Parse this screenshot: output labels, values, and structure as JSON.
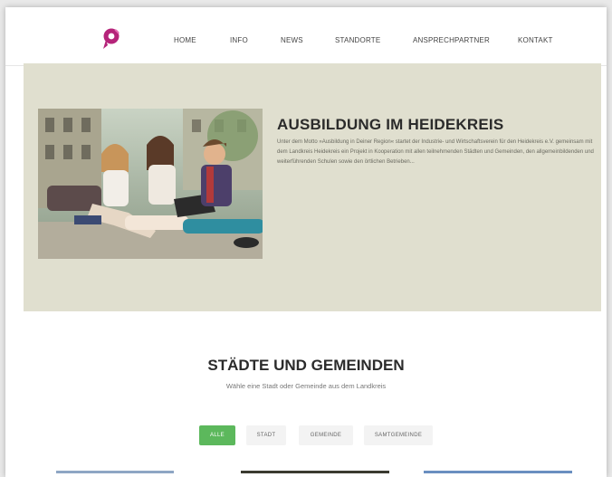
{
  "nav": {
    "items": [
      "HOME",
      "INFO",
      "NEWS",
      "STANDORTE",
      "ANSPRECHPARTNER",
      "KONTAKT"
    ]
  },
  "brand": {
    "logo_icon": "p-logo-icon",
    "color": "#b5247a"
  },
  "hero": {
    "title": "AUSBILDUNG IM HEIDEKREIS",
    "text": "Unter dem Motto »Ausbildung in Deiner Region« startet der Industrie- und Wirtschaftsverein für den Heidekreis e.V. gemeinsam mit dem Landkreis Heidekreis ein Projekt in Kooperation mit allen teilnehmenden Städten und Gemeinden, den allgemeinbildenden und weiterführenden Schulen sowie den örtlichen Betrieben...",
    "image": "students-sitting-with-laptop-photo",
    "background": "#e0dfcf"
  },
  "section": {
    "title": "STÄDTE UND GEMEINDEN",
    "subtitle": "Wähle eine Stadt oder Gemeinde aus dem Landkreis"
  },
  "filters": {
    "items": [
      "ALLE",
      "STADT",
      "GEMEINDE",
      "SAMTGEMEINDE"
    ],
    "active": "ALLE",
    "active_color": "#5cb85c"
  }
}
